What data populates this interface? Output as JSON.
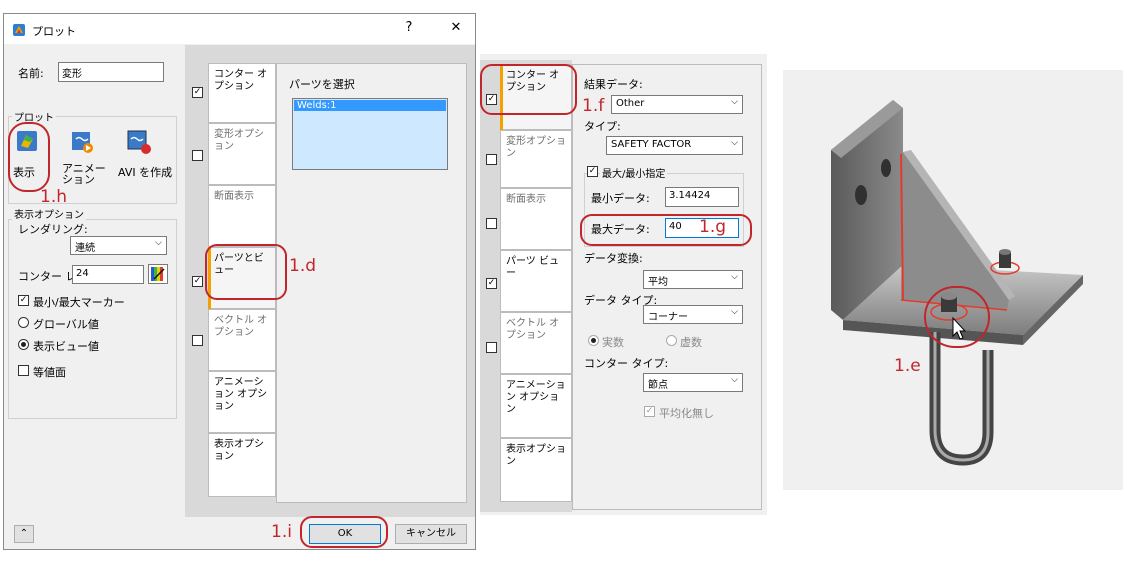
{
  "dialog": {
    "title": "プロット",
    "help": "?",
    "close": "✕",
    "name_label": "名前:",
    "name_value": "変形",
    "plot_group": "プロット",
    "plot_buttons": [
      "表示",
      "アニメーション",
      "AVI を作成"
    ],
    "display_options_group": "表示オプション",
    "rendering_label": "レンダリング:",
    "rendering_value": "連続",
    "contour_label": "コンター レ",
    "contour_value": "24",
    "minmax_marker": "最小/最大マーカー",
    "global_value": "グローバル値",
    "display_view_value": "表示ビュー値",
    "isosurface": "等値面",
    "tabs": [
      "コンター オプション",
      "変形オプション",
      "断面表示",
      "パーツとビュー",
      "ベクトル オプション",
      "アニメーション オプション",
      "表示オプション"
    ],
    "parts_select_label": "パーツを選択",
    "parts_list": [
      "Welds:1"
    ],
    "ok": "OK",
    "cancel": "キャンセル",
    "expand_icon": "double-chevron-up-icon"
  },
  "contour_panel": {
    "tabs": [
      "コンター オプション",
      "変形オプション",
      "断面表示",
      "パーツ ビュー",
      "ベクトル オプション",
      "アニメーション オプション",
      "表示オプション"
    ],
    "result_data_label": "結果データ:",
    "result_data_value": "Other",
    "type_label": "タイプ:",
    "type_value": "SAFETY FACTOR",
    "minmax_specify": "最大/最小指定",
    "min_data_label": "最小データ:",
    "min_data_value": "3.14424",
    "max_data_label": "最大データ:",
    "max_data_value": "40",
    "data_conversion_label": "データ変換:",
    "data_conversion_value": "平均",
    "data_type_label": "データ タイプ:",
    "data_type_value": "コーナー",
    "real": "実数",
    "imaginary": "虚数",
    "contour_type_label": "コンター タイプ:",
    "contour_type_value": "節点",
    "no_smoothing": "平均化無し"
  },
  "annotations": {
    "h": "1.h",
    "d": "1.d",
    "i": "1.i",
    "f": "1.f",
    "g": "1.g",
    "e": "1.e"
  },
  "colors": {
    "accent": "#c0262b",
    "tab_bar": "#f2a100",
    "selection": "#3399ff"
  }
}
